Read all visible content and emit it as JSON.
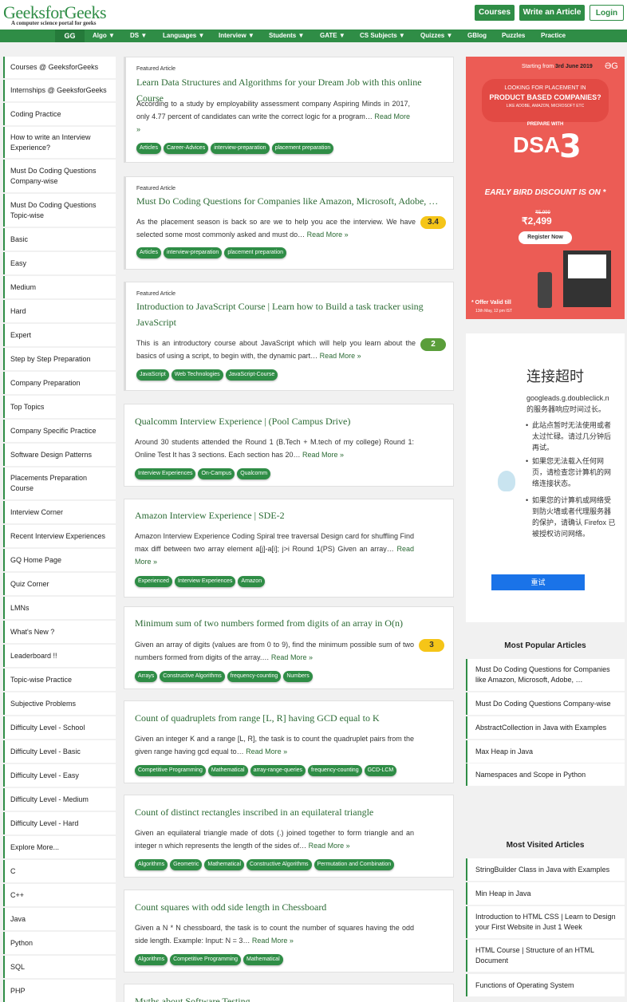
{
  "header": {
    "logo": "GeeksforGeeks",
    "tagline": "A computer science portal for geeks",
    "courses_btn": "Courses",
    "write_btn": "Write an Article",
    "login_btn": "Login"
  },
  "nav": {
    "home": "GG",
    "items": [
      "Algo ▼",
      "DS ▼",
      "Languages ▼",
      "Interview ▼",
      "Students ▼",
      "GATE ▼",
      "CS Subjects ▼",
      "Quizzes ▼",
      "GBlog",
      "Puzzles",
      "Practice"
    ]
  },
  "sidebar": {
    "items": [
      "Courses @ GeeksforGeeks",
      "Internships @ GeeksforGeeks",
      "Coding Practice",
      "How to write an Interview Experience?",
      "Must Do Coding Questions Company-wise",
      "Must Do Coding Questions Topic-wise",
      "Basic",
      "Easy",
      "Medium",
      "Hard",
      "Expert",
      "Step by Step Preparation",
      "Company Preparation",
      "Top Topics",
      "Company Specific Practice",
      "Software Design Patterns",
      "Placements Preparation Course",
      "Interview Corner",
      "Recent Interview Experiences",
      "GQ Home Page",
      "Quiz Corner",
      "LMNs",
      "What's New ?",
      "Leaderboard !!",
      "Topic-wise Practice",
      "Subjective Problems",
      "Difficulty Level - School",
      "Difficulty Level - Basic",
      "Difficulty Level - Easy",
      "Difficulty Level - Medium",
      "Difficulty Level - Hard",
      "Explore More...",
      "C",
      "C++",
      "Java",
      "Python",
      "SQL",
      "PHP"
    ]
  },
  "articles": [
    {
      "kicker": "Featured Article",
      "title": "Learn Data Structures and Algorithms for your Dream Job with this online Course",
      "excerpt": "According to a study by employability assessment company Aspiring Minds in 2017, only 4.77 percent of candidates can write the correct logic for a program…",
      "more": "Read More »",
      "tags": [
        "Articles",
        "Career-Advices",
        "interview-preparation",
        "placement preparation"
      ],
      "badge": ""
    },
    {
      "kicker": "Featured Article",
      "title": "Must Do Coding Questions for Companies like Amazon, Microsoft, Adobe, …",
      "excerpt": "As the placement season is back so are we to help you ace the interview. We have selected some most commonly asked and must do…",
      "more": "Read More »",
      "tags": [
        "Articles",
        "interview-preparation",
        "placement preparation"
      ],
      "badge": "3.4"
    },
    {
      "kicker": "Featured Article",
      "title": "Introduction to JavaScript Course | Learn how to Build a task tracker using JavaScript",
      "excerpt": "This is an introductory course about JavaScript which will help you learn about the basics of using a script, to begin with, the dynamic part…",
      "more": "Read More »",
      "tags": [
        "JavaScript",
        "Web Technologies",
        "JavaScript-Course"
      ],
      "badge": "2"
    },
    {
      "kicker": "",
      "title": "Qualcomm Interview Experience | (Pool Campus Drive)",
      "excerpt": "Around 30 students attended the Round 1 (B.Tech + M.tech of my college) Round 1: Online Test It has 3 sections. Each section has 20…",
      "more": "Read More »",
      "tags": [
        "Interview Experiences",
        "On-Campus",
        "Qualcomm"
      ],
      "badge": ""
    },
    {
      "kicker": "",
      "title": "Amazon Interview Experience | SDE-2",
      "excerpt": "Amazon Interview Experience Coding Spiral tree traversal Design card for shuffling Find max diff between two array element a[j]-a[i]; j>i Round 1(PS) Given an array…",
      "more": "Read More »",
      "tags": [
        "Experienced",
        "Interview Experiences",
        "Amazon"
      ],
      "badge": ""
    },
    {
      "kicker": "",
      "title": "Minimum sum of two numbers formed from digits of an array in O(n)",
      "excerpt": "Given an array of digits (values are from 0 to 9), find the minimum possible sum of two numbers formed from digits of the array.…",
      "more": "Read More »",
      "tags": [
        "Arrays",
        "Constructive Algorithms",
        "frequency-counting",
        "Numbers"
      ],
      "badge": "3"
    },
    {
      "kicker": "",
      "title": "Count of quadruplets from range [L, R] having GCD equal to K",
      "excerpt": "Given an integer K and a range [L, R], the task is to count the quadruplet pairs from the given range having gcd equal to…",
      "more": "Read More »",
      "tags": [
        "Competitive Programming",
        "Mathematical",
        "array-range-queries",
        "frequency-counting",
        "GCD-LCM"
      ],
      "badge": ""
    },
    {
      "kicker": "",
      "title": "Count of distinct rectangles inscribed in an equilateral triangle",
      "excerpt": "Given an equilateral triangle made of dots (.) joined together to form triangle and an integer n which represents the length of the sides of…",
      "more": "Read More »",
      "tags": [
        "Algorithms",
        "Geometric",
        "Mathematical",
        "Constructive Algorithms",
        "Permutation and Combination"
      ],
      "badge": ""
    },
    {
      "kicker": "",
      "title": "Count squares with odd side length in Chessboard",
      "excerpt": "Given a N * N chessboard, the task is to count the number of squares having the odd side length. Example: Input: N = 3…",
      "more": "Read More »",
      "tags": [
        "Algorithms",
        "Competitive Programming",
        "Mathematical"
      ],
      "badge": ""
    },
    {
      "kicker": "",
      "title": "Myths about Software Testing",
      "excerpt": "",
      "more": "",
      "tags": [],
      "badge": ""
    }
  ],
  "ad": {
    "starting": "Starting from",
    "date": "3rd June 2019",
    "looking": "LOOKING FOR PLACEMENT IN",
    "product": "PRODUCT BASED COMPANIES?",
    "like": "LIKE ADOBE, AMAZON, MICROSOFT ETC",
    "prepare": "PREPARE WITH",
    "dsa": "DSA",
    "three": "3",
    "early": "EARLY BIRD DISCOUNT IS ON",
    "old_price": "₹5,999",
    "price": "₹2,499",
    "register": "Register Now",
    "offer": "* Offer Valid till",
    "offer_date": "13th May, 12 pm IST"
  },
  "ad2": {
    "heading": "连接超时",
    "host": "googleads.g.doubleclick.n",
    "desc": "的服务器响应时间过长。",
    "bullets": [
      "此站点暂时无法使用或者太过忙碌。请过几分钟后再试。",
      "如果您无法载入任何网页，请检查您计算机的网络连接状态。",
      "如果您的计算机或网络受到防火墙或者代理服务器的保护，请确认 Firefox 已被授权访问网络。"
    ],
    "retry": "重试"
  },
  "popular": {
    "title": "Most Popular Articles",
    "items": [
      "Must Do Coding Questions for Companies like Amazon, Microsoft, Adobe, …",
      "Must Do Coding Questions Company-wise",
      "AbstractCollection in Java with Examples",
      "Max Heap in Java",
      "Namespaces and Scope in Python"
    ]
  },
  "visited": {
    "title": "Most Visited Articles",
    "items": [
      "StringBuilder Class in Java with Examples",
      "Min Heap in Java",
      "Introduction to HTML CSS | Learn to Design your First Website in Just 1 Week",
      "HTML Course | Structure of an HTML Document",
      "Functions of Operating System"
    ]
  },
  "colors": {
    "brand": "#2f8d46",
    "badge_yellow": "#f5c518",
    "badge_green": "#5a9e3a",
    "ad_red": "#ec5c55"
  }
}
